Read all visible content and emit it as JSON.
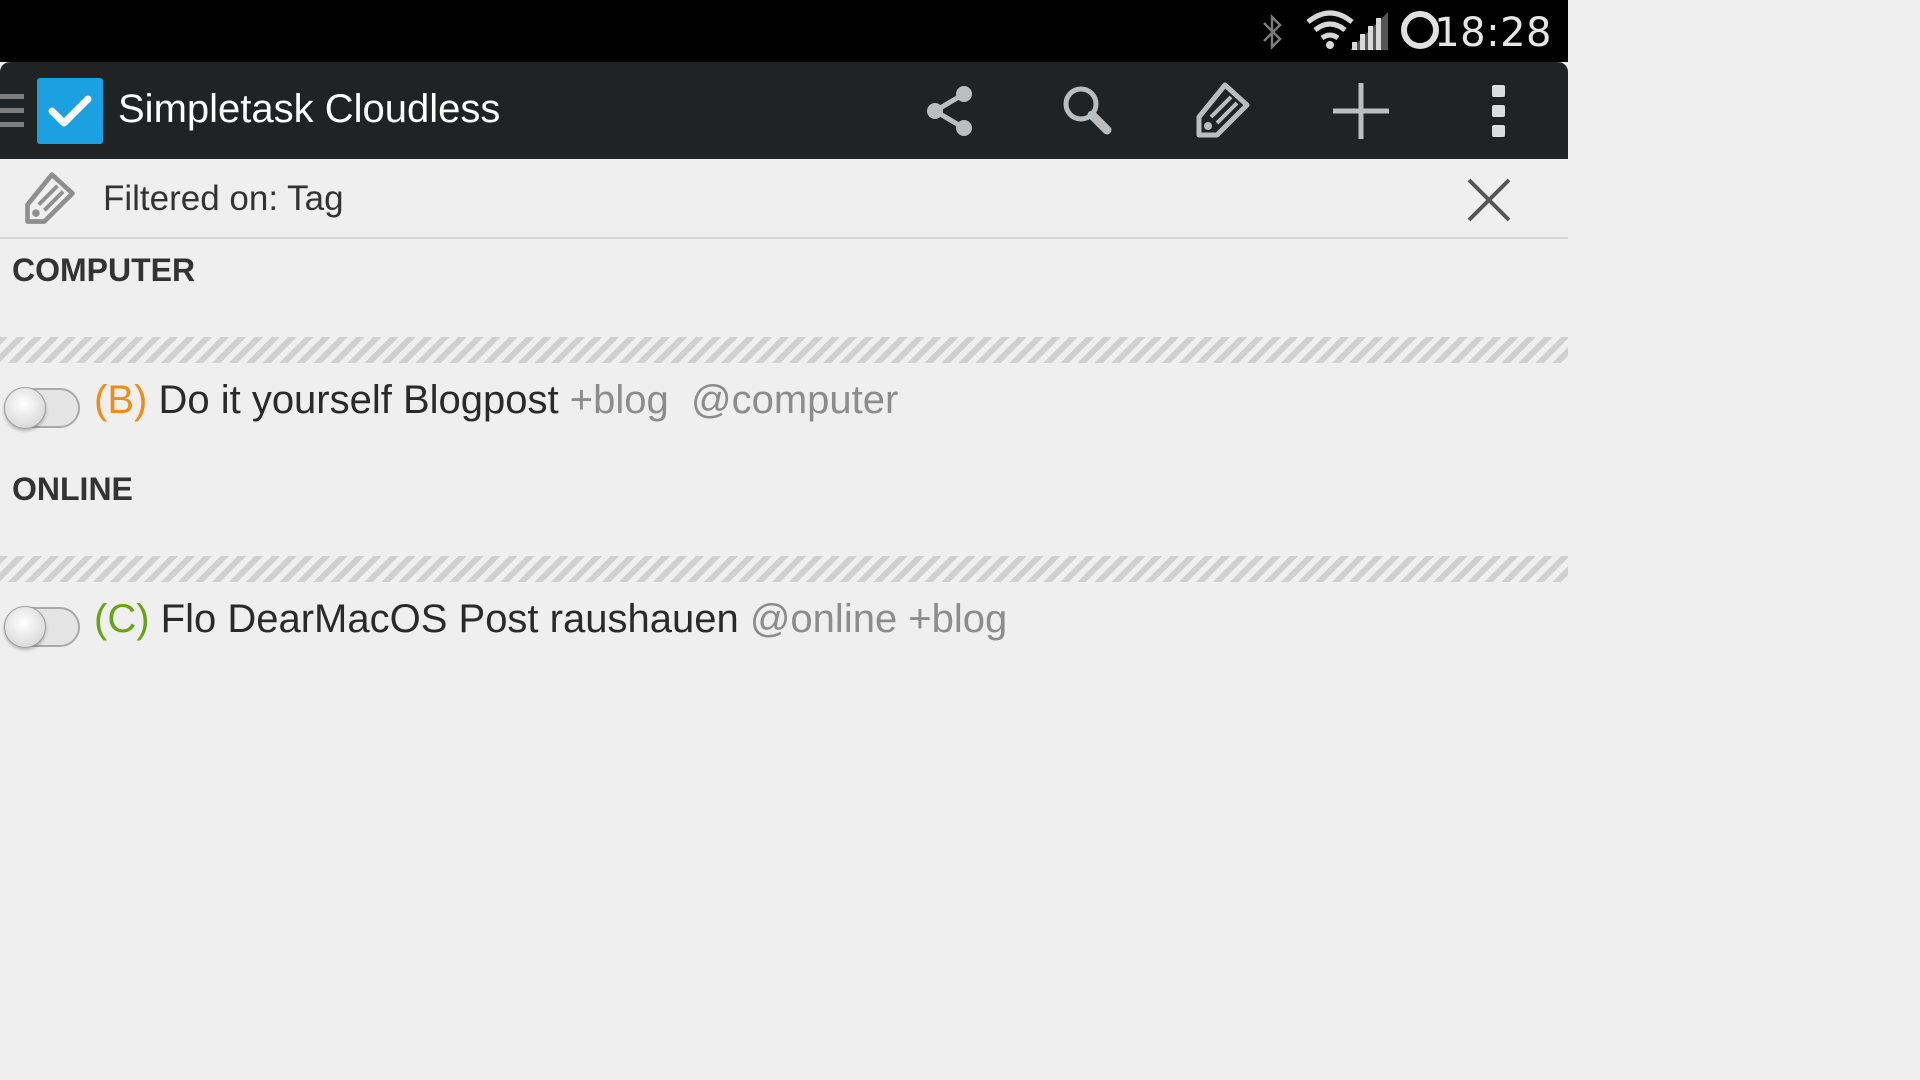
{
  "status_bar": {
    "time": "18:28",
    "icons": [
      "bluetooth-icon",
      "wifi-icon",
      "signal-icon",
      "sync-icon"
    ],
    "text_color": "#e6e6e6"
  },
  "action_bar": {
    "title": "Simpletask Cloudless",
    "background": "#212224",
    "logo_color": "#1ba0e1",
    "actions": [
      "share-icon",
      "search-icon",
      "tag-icon",
      "add-icon",
      "overflow-menu-icon"
    ]
  },
  "filter_bar": {
    "text": "Filtered on: Tag",
    "icon": "tag-icon",
    "close_icon": "close-icon"
  },
  "sections": [
    {
      "header": "COMPUTER",
      "tasks": [
        {
          "priority": "(B)",
          "text": "Do it yourself Blogpost",
          "tags": "+blog  @computer",
          "completed": false
        }
      ]
    },
    {
      "header": "ONLINE",
      "tasks": [
        {
          "priority": "(C)",
          "text": "Flo DearMacOS Post raushauen",
          "tags": "@online +blog",
          "completed": false
        }
      ]
    }
  ],
  "colors": {
    "priority_b": "#f08c1a",
    "priority_c": "#6aa219",
    "tag": "#8c8c8c",
    "background": "#efefef"
  }
}
